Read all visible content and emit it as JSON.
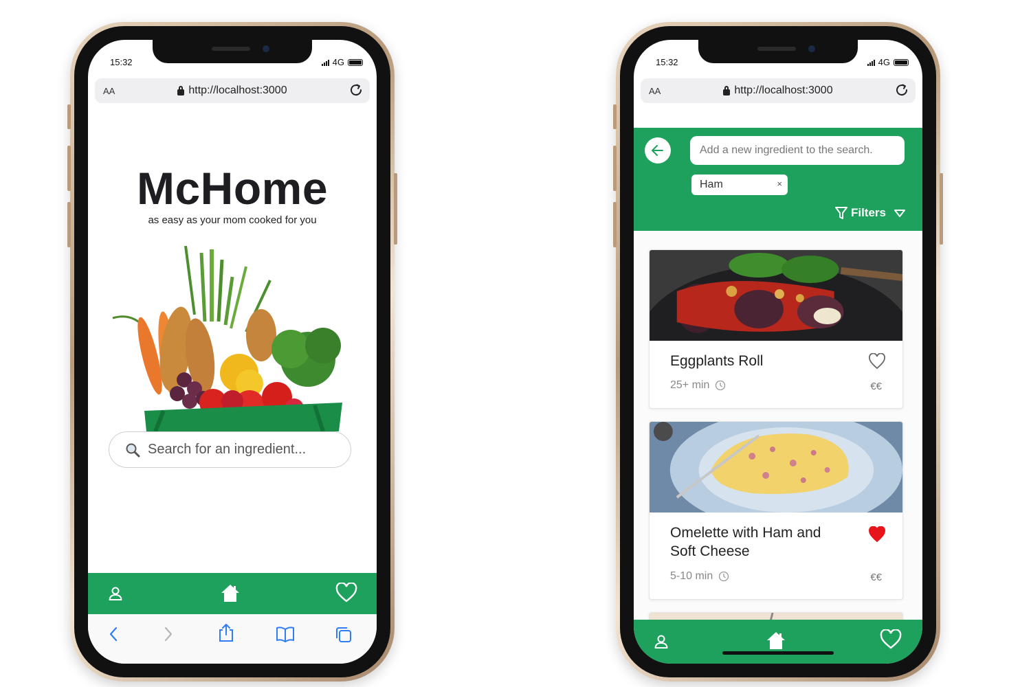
{
  "status": {
    "time": "15:32",
    "network": "4G"
  },
  "browser": {
    "text_size": "AA",
    "url": "http://localhost:3000"
  },
  "home": {
    "brand": "McHome",
    "tagline": "as easy as your mom cooked for you",
    "search_placeholder": "Search for an ingredient..."
  },
  "results": {
    "add_placeholder": "Add a new ingredient to the search.",
    "chips": [
      {
        "label": "Ham",
        "remove": "×"
      }
    ],
    "filters_label": "Filters",
    "recipes": [
      {
        "title": "Eggplants Roll",
        "time": "25+ min",
        "price": "€€",
        "favorite": false
      },
      {
        "title": "Omelette with Ham and Soft Cheese",
        "time": "5-10 min",
        "price": "€€",
        "favorite": true
      }
    ]
  },
  "icons": {
    "profile": "user-icon",
    "home": "home-icon",
    "favorites": "heart-icon",
    "search": "magnifier-icon",
    "back": "arrow-left-icon",
    "filter": "funnel-icon",
    "clock": "clock-icon",
    "reload": "reload-icon",
    "lock": "lock-icon",
    "safari_back": "chevron-left-icon",
    "safari_forward": "chevron-right-icon",
    "share": "share-icon",
    "bookmarks": "book-icon",
    "tabs": "tabs-icon"
  },
  "colors": {
    "accent": "#1da15c",
    "favorite": "#e8141c"
  }
}
